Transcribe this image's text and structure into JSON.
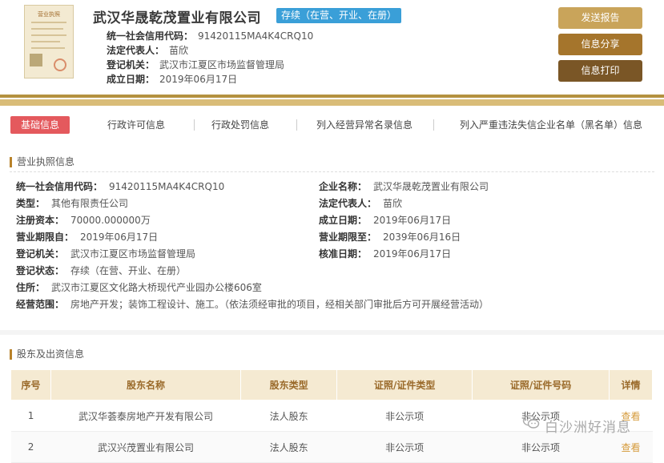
{
  "header": {
    "thumbnail_caption": "营业执照",
    "company_name": "武汉华晟乾茂置业有限公司",
    "status_tag": "存续（在营、开业、在册）",
    "credit_code_label": "统一社会信用代码：",
    "credit_code": "91420115MA4K4CRQ10",
    "legal_rep_label": "法定代表人：",
    "legal_rep": "苗欣",
    "authority_label": "登记机关：",
    "authority": "武汉市江夏区市场监督管理局",
    "established_label": "成立日期：",
    "established": "2019年06月17日"
  },
  "side_buttons": {
    "send_report": "发送报告",
    "share": "信息分享",
    "print": "信息打印"
  },
  "colors": {
    "gold_dark": "#b4913f",
    "gold_mid": "#c9a45a",
    "gold_light": "#d9bc78",
    "red_tab": "#e4595d",
    "status_blue": "#3a9fd8"
  },
  "tabs": [
    {
      "label": "基础信息"
    },
    {
      "label": "行政许可信息"
    },
    {
      "label": "行政处罚信息"
    },
    {
      "label": "列入经营异常名录信息"
    },
    {
      "label": "列入严重违法失信企业名单（黑名单）信息"
    }
  ],
  "license": {
    "title": "营业执照信息",
    "credit_code_label": "统一社会信用代码：",
    "credit_code": "91420115MA4K4CRQ10",
    "company_label": "企业名称：",
    "company": "武汉华晟乾茂置业有限公司",
    "type_label": "类型：",
    "type": "其他有限责任公司",
    "legal_rep_label": "法定代表人：",
    "legal_rep": "苗欣",
    "capital_label": "注册资本：",
    "capital": "70000.000000万",
    "established_label": "成立日期：",
    "established": "2019年06月17日",
    "term_from_label": "营业期限自：",
    "term_from": "2019年06月17日",
    "term_to_label": "营业期限至：",
    "term_to": "2039年06月16日",
    "authority_label": "登记机关：",
    "authority": "武汉市江夏区市场监督管理局",
    "approval_label": "核准日期：",
    "approval": "2019年06月17日",
    "reg_status_label": "登记状态：",
    "reg_status": "存续（在营、开业、在册）",
    "address_label": "住所：",
    "address": "武汉市江夏区文化路大桥现代产业园办公楼606室",
    "scope_label": "经营范围：",
    "scope": "房地产开发；装饰工程设计、施工。（依法须经审批的项目，经相关部门审批后方可开展经营活动）"
  },
  "shareholders": {
    "title": "股东及出资信息",
    "headers": [
      "序号",
      "股东名称",
      "股东类型",
      "证照/证件类型",
      "证照/证件号码",
      "详情"
    ],
    "rows": [
      [
        "1",
        "武汉华荟泰房地产开发有限公司",
        "法人股东",
        "非公示项",
        "非公示项",
        "查看"
      ],
      [
        "2",
        "武汉兴茂置业有限公司",
        "法人股东",
        "非公示项",
        "非公示项",
        "查看"
      ]
    ]
  },
  "watermark": "白沙洲好消息"
}
